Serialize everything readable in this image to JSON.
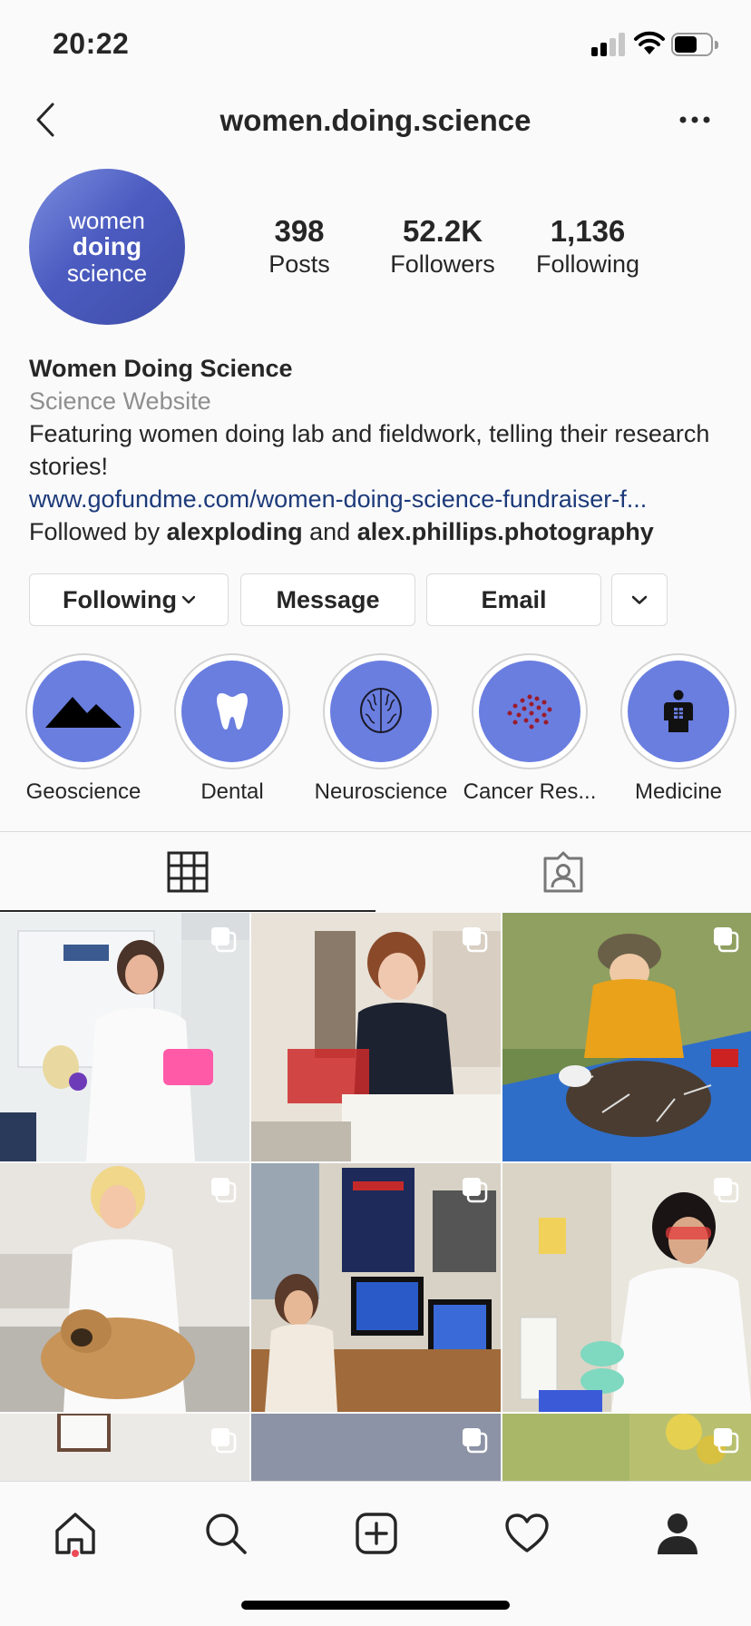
{
  "status_bar": {
    "time": "20:22"
  },
  "nav": {
    "title": "women.doing.science"
  },
  "avatar": {
    "line1": "women",
    "line2": "doing",
    "line3": "science"
  },
  "stats": [
    {
      "value": "398",
      "label": "Posts"
    },
    {
      "value": "52.2K",
      "label": "Followers"
    },
    {
      "value": "1,136",
      "label": "Following"
    }
  ],
  "bio": {
    "name": "Women Doing Science",
    "category": "Science Website",
    "text": "Featuring women doing lab and fieldwork, telling their research stories!",
    "link": "www.gofundme.com/women-doing-science-fundraiser-f...",
    "followed_by_prefix": "Followed by",
    "followed_by_user1": "alexploding",
    "followed_by_and": "and",
    "followed_by_user2": "alex.phillips.photography"
  },
  "actions": {
    "following_label": "Following",
    "message_label": "Message",
    "email_label": "Email"
  },
  "highlights": [
    {
      "label": "Geoscience",
      "icon": "mountain-icon"
    },
    {
      "label": "Dental",
      "icon": "tooth-icon"
    },
    {
      "label": "Neuroscience",
      "icon": "brain-icon"
    },
    {
      "label": "Cancer Res...",
      "icon": "cells-icon"
    },
    {
      "label": "Medicine",
      "icon": "body-icon"
    }
  ],
  "tabs": [
    {
      "name": "grid",
      "icon": "grid-icon",
      "active": true
    },
    {
      "name": "tagged",
      "icon": "tagged-icon",
      "active": false
    }
  ],
  "posts": [
    {
      "kind": "lab-incubator",
      "icon": "multi-post-icon"
    },
    {
      "kind": "lab-gel",
      "icon": "multi-post-icon"
    },
    {
      "kind": "field-porcupine",
      "icon": "multi-post-icon"
    },
    {
      "kind": "vet-dog",
      "icon": "multi-post-icon"
    },
    {
      "kind": "office-computers",
      "icon": "multi-post-icon"
    },
    {
      "kind": "lab-pipette",
      "icon": "multi-post-icon"
    },
    {
      "kind": "partial-1",
      "icon": "multi-post-icon"
    },
    {
      "kind": "partial-2",
      "icon": "multi-post-icon"
    },
    {
      "kind": "partial-3",
      "icon": "multi-post-icon"
    }
  ],
  "bottom_nav": [
    {
      "name": "home",
      "icon": "home-icon"
    },
    {
      "name": "search",
      "icon": "search-icon"
    },
    {
      "name": "new-post",
      "icon": "add-post-icon"
    },
    {
      "name": "activity",
      "icon": "heart-icon"
    },
    {
      "name": "profile",
      "icon": "profile-icon"
    }
  ],
  "colors": {
    "highlight_fill": "#6a7ee0",
    "link": "#1d3a7a",
    "notification": "#ed4956"
  }
}
